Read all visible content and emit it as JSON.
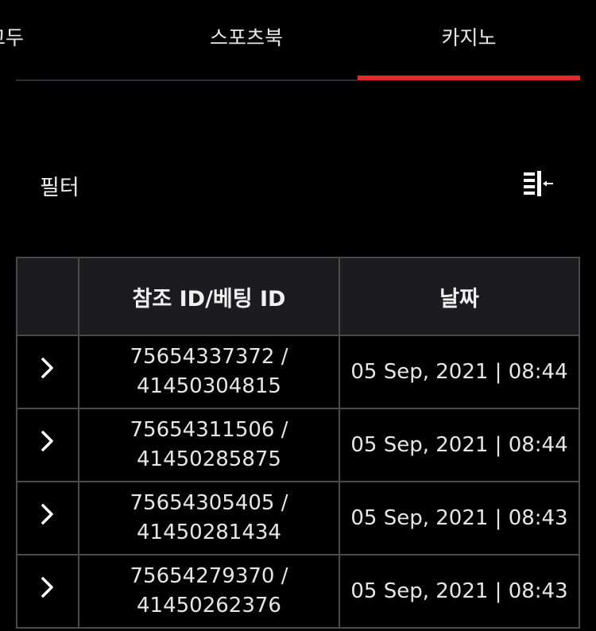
{
  "tabs": [
    {
      "label": "모두",
      "visible_text": "고두",
      "active": false
    },
    {
      "label": "스포츠북",
      "active": false
    },
    {
      "label": "카지노",
      "active": true
    }
  ],
  "colors": {
    "background": "#000000",
    "accent": "#e3292b",
    "header_bg": "#1c1c1e",
    "border": "#4a4a4a"
  },
  "filter": {
    "label": "필터",
    "icon": "collapse-left-icon"
  },
  "table": {
    "headers": [
      "",
      "참조 ID/베팅 ID",
      "날짜"
    ],
    "rows": [
      {
        "ref_id": "75654337372 /",
        "bet_id": "41450304815",
        "date": "05 Sep, 2021 | 08:44"
      },
      {
        "ref_id": "75654311506 /",
        "bet_id": "41450285875",
        "date": "05 Sep, 2021 | 08:44"
      },
      {
        "ref_id": "75654305405 /",
        "bet_id": "41450281434",
        "date": "05 Sep, 2021 | 08:43"
      },
      {
        "ref_id": "75654279370 /",
        "bet_id": "41450262376",
        "date": "05 Sep, 2021 | 08:43"
      }
    ],
    "row_icon": "chevron-right-icon"
  }
}
